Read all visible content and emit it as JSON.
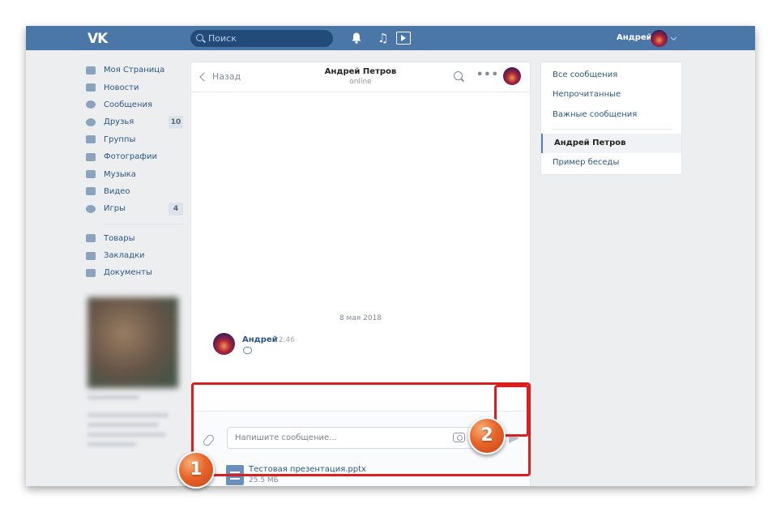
{
  "topbar": {
    "logo": "VK",
    "search_placeholder": "Поиск",
    "user_name": "Андрей"
  },
  "sidebar": {
    "items": [
      {
        "label": "Моя Страница",
        "icon": "home-icon"
      },
      {
        "label": "Новости",
        "icon": "news-icon"
      },
      {
        "label": "Сообщения",
        "icon": "messages-icon"
      },
      {
        "label": "Друзья",
        "icon": "friends-icon",
        "count": "10"
      },
      {
        "label": "Группы",
        "icon": "groups-icon"
      },
      {
        "label": "Фотографии",
        "icon": "camera-icon"
      },
      {
        "label": "Музыка",
        "icon": "music-icon"
      },
      {
        "label": "Видео",
        "icon": "video-icon"
      },
      {
        "label": "Игры",
        "icon": "gamepad-icon",
        "count": "4"
      }
    ],
    "items2": [
      {
        "label": "Товары",
        "icon": "bag-icon"
      },
      {
        "label": "Закладки",
        "icon": "star-icon"
      },
      {
        "label": "Документы",
        "icon": "document-icon"
      }
    ]
  },
  "chat": {
    "back_label": "Назад",
    "contact_name": "Андрей Петров",
    "contact_status": "online",
    "date_separator": "8 мая 2018",
    "message": {
      "author": "Андрей",
      "time": "22:46"
    },
    "composer": {
      "placeholder": "Напишите сообщение...",
      "attachment_name": "Тестовая презентация.pptx",
      "attachment_size": "25.5 МБ"
    }
  },
  "right_panel": {
    "filters": [
      "Все сообщения",
      "Непрочитанные",
      "Важные сообщения"
    ],
    "conversations": [
      "Андрей Петров",
      "Пример беседы"
    ]
  },
  "annotations": {
    "badge_1": "1",
    "badge_2": "2",
    "highlight_color": "#d91f1f"
  },
  "colors": {
    "header_blue": "#4a76a8",
    "link_blue": "#2a5885",
    "background": "#edeef0"
  }
}
